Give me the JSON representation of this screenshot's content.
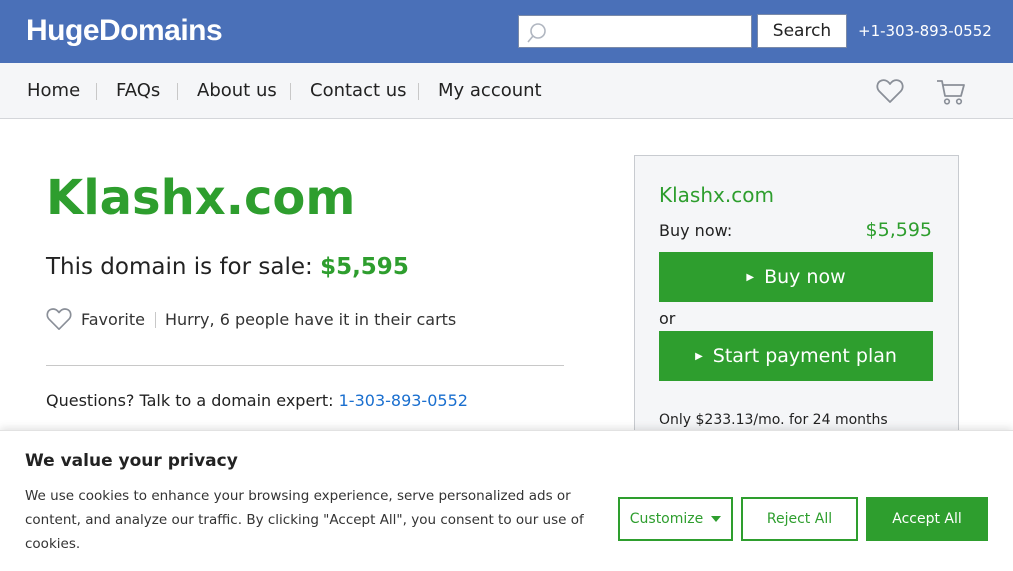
{
  "header": {
    "logo": "HugeDomains",
    "search": {
      "placeholder": "",
      "value": "",
      "button_label": "Search"
    },
    "phone": "+1-303-893-0552"
  },
  "nav": {
    "items": [
      {
        "label": "Home"
      },
      {
        "label": "FAQs"
      },
      {
        "label": "About us"
      },
      {
        "label": "Contact us"
      },
      {
        "label": "My account"
      }
    ],
    "icons": [
      "heart-icon",
      "cart-icon"
    ]
  },
  "main": {
    "domain": "Klashx.com",
    "for_sale_prefix": "This domain is for sale:",
    "price": "$5,595",
    "favorite_label": "Favorite",
    "hurry_text": "Hurry, 6 people have it in their carts",
    "questions_prefix": "Questions? Talk to a domain expert:",
    "questions_phone": "1-303-893-0552"
  },
  "sidebar": {
    "domain": "Klashx.com",
    "buy_label": "Buy now:",
    "buy_price": "$5,595",
    "buy_button": "Buy now",
    "or_label": "or",
    "plan_button": "Start payment plan",
    "monthly_text": "Only $233.13/mo. for 24 months"
  },
  "cookie": {
    "title": "We value your privacy",
    "text": "We use cookies to enhance your browsing experience, serve personalized ads or content, and analyze our traffic. By clicking \"Accept All\", you consent to our use of cookies.",
    "customize_label": "Customize",
    "reject_label": "Reject All",
    "accept_label": "Accept All"
  },
  "colors": {
    "header_bg": "#4a70b8",
    "brand_green": "#2e9e2e",
    "link_blue": "#1a6fcf",
    "nav_bg": "#f5f6f8"
  }
}
